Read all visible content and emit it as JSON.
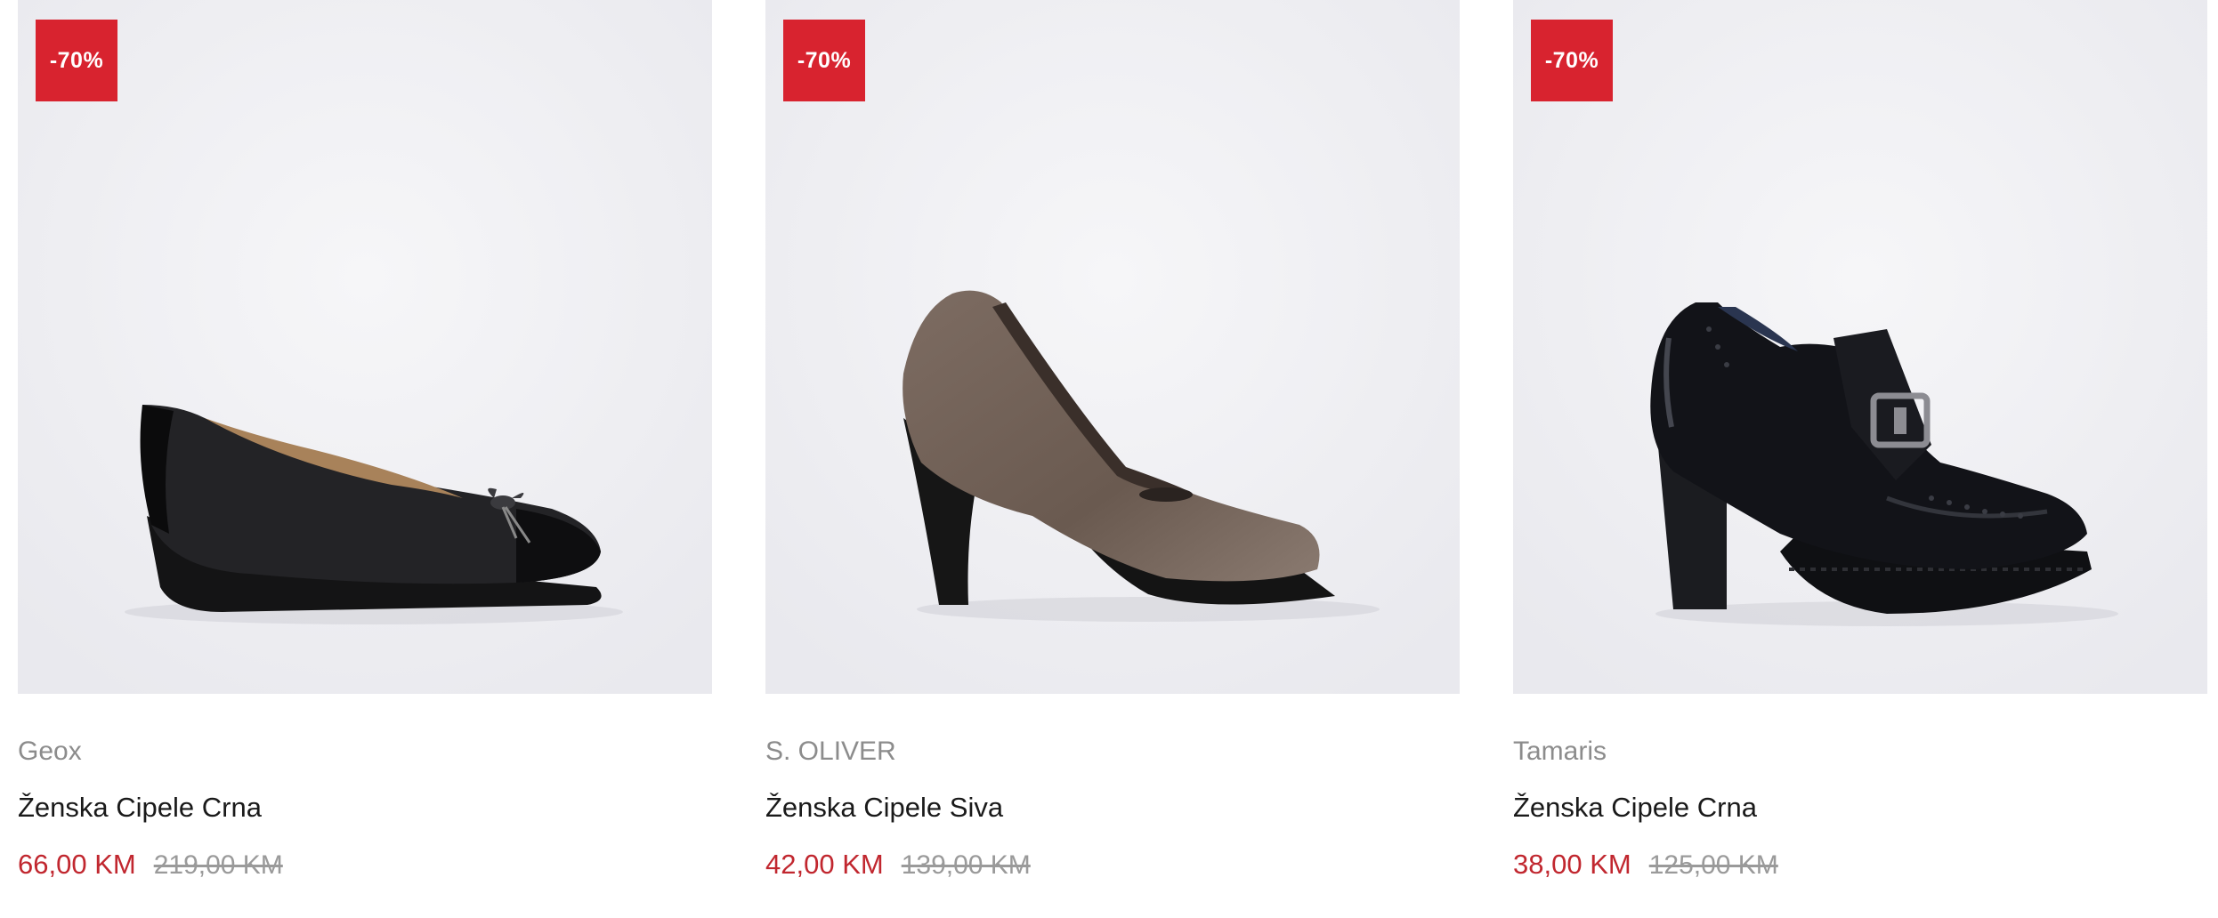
{
  "products": [
    {
      "badge": "-70%",
      "brand": "Geox",
      "title": "Ženska Cipele Crna",
      "price_new": "66,00 KM",
      "price_old": "219,00 KM",
      "shoe_color": "#1f1f21"
    },
    {
      "badge": "-70%",
      "brand": "S. OLIVER",
      "title": "Ženska Cipele Siva",
      "price_new": "42,00 KM",
      "price_old": "139,00 KM",
      "shoe_color": "#6d5e55"
    },
    {
      "badge": "-70%",
      "brand": "Tamaris",
      "title": "Ženska Cipele Crna",
      "price_new": "38,00 KM",
      "price_old": "125,00 KM",
      "shoe_color": "#15171b"
    }
  ],
  "colors": {
    "badge_bg": "#d8232f",
    "sale_price": "#c1272f",
    "image_bg": "#efeff3"
  }
}
